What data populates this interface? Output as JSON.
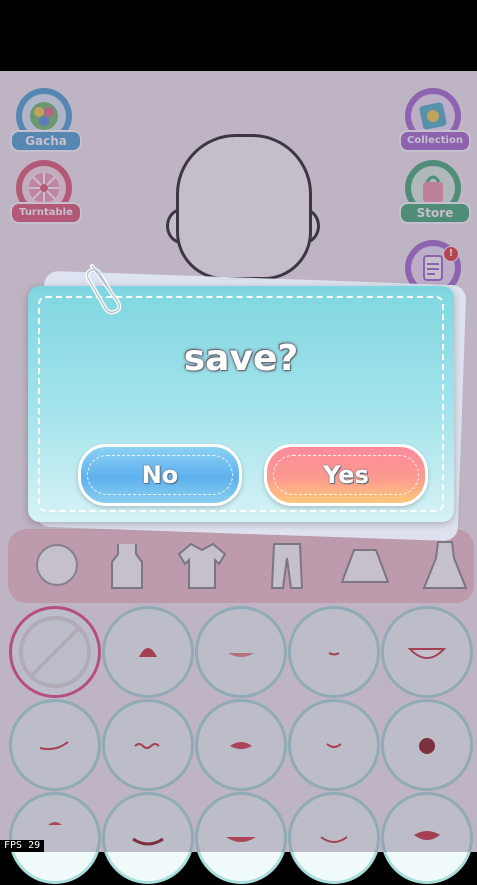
{
  "side_buttons": {
    "gacha": "Gacha",
    "turntable": "Turntable",
    "collection": "Collection",
    "store": "Store"
  },
  "dialog": {
    "title": "save?",
    "no_label": "No",
    "yes_label": "Yes"
  },
  "fps": "FPS  29",
  "colors": {
    "dialog_teal": "#7fd6e0",
    "no_blue": "#5fb0ee",
    "yes_pink": "#fb8a9c",
    "cell_border": "#a9dedc",
    "selected_border": "#e44b88",
    "gacha_blue": "#4aa5d6",
    "turntable_red": "#e05a77",
    "collection_purple": "#a46ad0",
    "store_green": "#3fae7a"
  },
  "category_icons": [
    "head-icon",
    "tank-top-icon",
    "shirt-icon",
    "pants-icon",
    "skirt-icon",
    "dress-icon"
  ],
  "mouth_options": [
    "none",
    "open-mouth",
    "smile-line",
    "small-dot",
    "grin-teeth",
    "smirk",
    "wavy",
    "red-lips",
    "thin-curve",
    "round-dot",
    "lip",
    "kiss",
    "lips-smile",
    "soft-smile",
    "red-lips-2"
  ]
}
